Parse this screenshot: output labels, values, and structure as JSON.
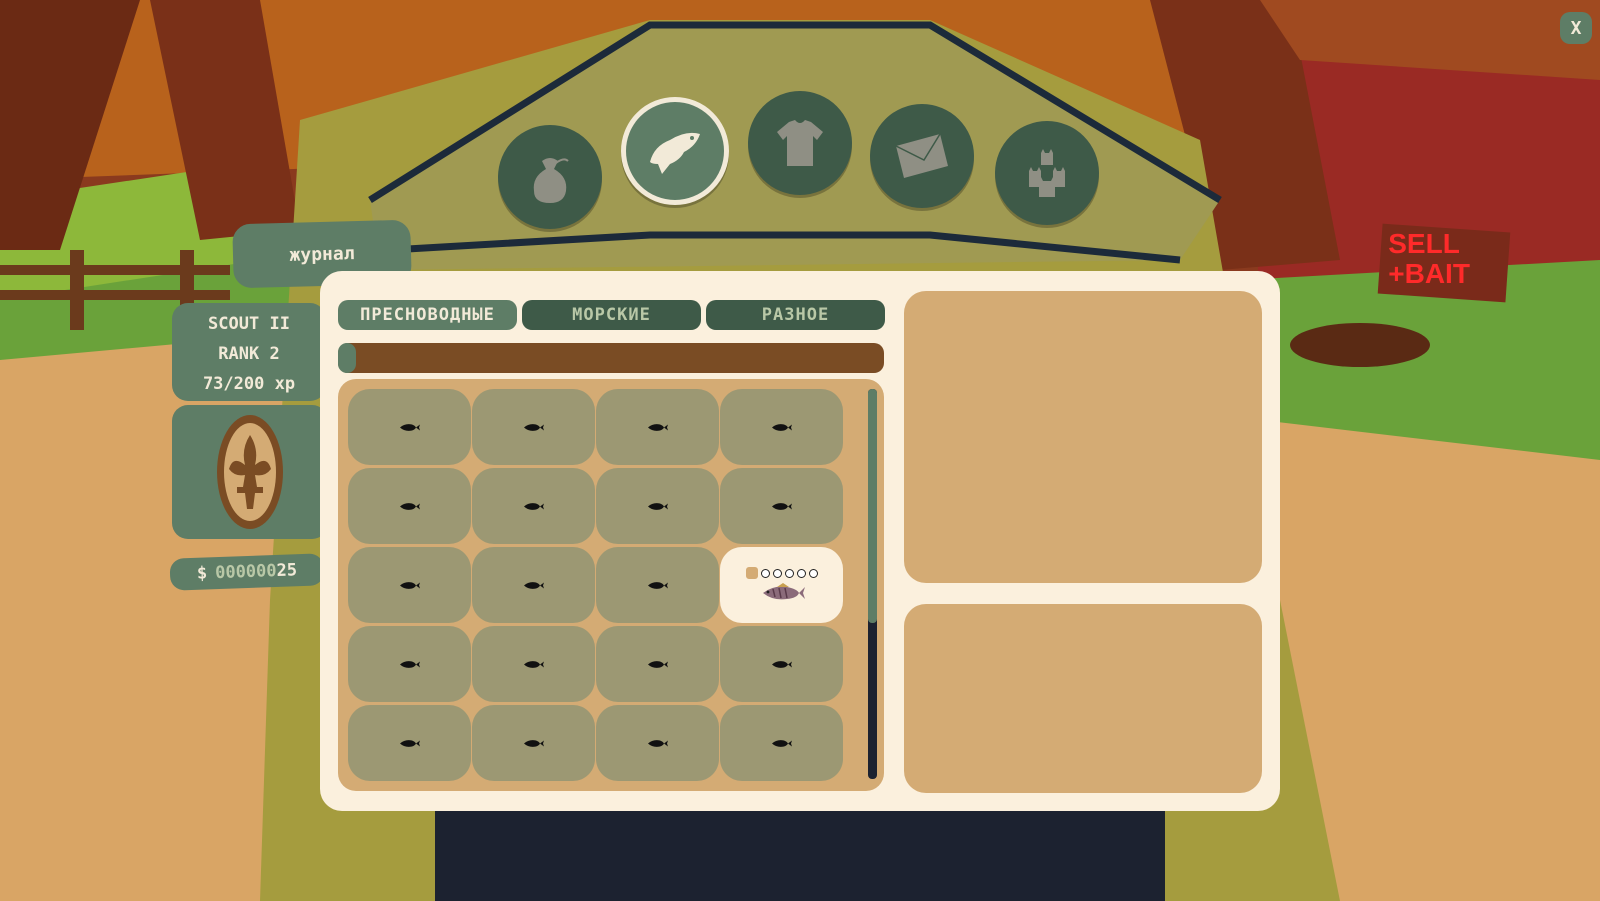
{
  "journal_label": "журнал",
  "player": {
    "name": "SCOUT II",
    "rank": "RANK 2",
    "xp": "73/200 xp",
    "xp_fraction": 0.365,
    "money_prefix": "$",
    "money_zeros": "000000",
    "money_value": "25"
  },
  "top_tabs": [
    {
      "name": "bag-icon",
      "active": false
    },
    {
      "name": "fish-icon",
      "active": true
    },
    {
      "name": "shirt-icon",
      "active": false
    },
    {
      "name": "mail-icon",
      "active": false
    },
    {
      "name": "cats-icon",
      "active": false
    }
  ],
  "categories": [
    {
      "label": "ПРЕСНОВОДНЫЕ",
      "active": true
    },
    {
      "label": "МОРСКИЕ",
      "active": false
    },
    {
      "label": "РАЗНОЕ",
      "active": false
    }
  ],
  "collection_progress": 0.03,
  "scroll_fraction": 0.6,
  "fish_grid": {
    "columns": 4,
    "rows": 5,
    "caught_index": 11,
    "caught_stars": 1,
    "star_total": 6
  },
  "close_label": "X",
  "sign_text": [
    "SELL",
    "+BAIT"
  ],
  "colors": {
    "panel": "#fbf0dd",
    "green": "#5e7d66",
    "dark_green": "#3e5a48",
    "tan": "#d4ab74",
    "brown": "#7a4c24"
  }
}
